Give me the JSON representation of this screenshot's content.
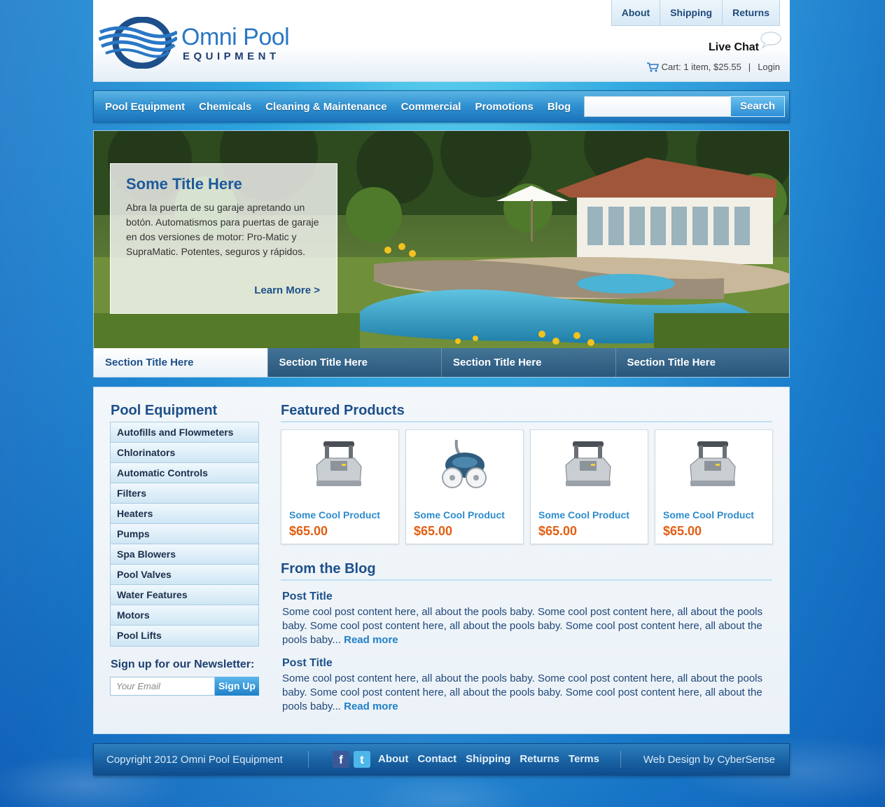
{
  "header": {
    "logo_line1": "Omni Pool",
    "logo_line2": "EQUIPMENT",
    "top_links": [
      "About",
      "Shipping",
      "Returns"
    ],
    "live_chat": "Live Chat",
    "cart": "Cart: 1 item, $25.55",
    "login": "Login"
  },
  "nav": {
    "items": [
      "Pool Equipment",
      "Chemicals",
      "Cleaning & Maintenance",
      "Commercial",
      "Promotions",
      "Blog"
    ],
    "search_value": "",
    "search_label": "Search"
  },
  "hero": {
    "title": "Some Title Here",
    "body": "Abra la puerta de su garaje apretando un botón. Automatismos para puertas de garaje en dos versiones de motor: Pro-Matic y SupraMatic. Potentes, seguros y rápidos.",
    "cta": "Learn More >",
    "tabs": [
      "Section Title Here",
      "Section Title Here",
      "Section Title Here",
      "Section Title Here"
    ]
  },
  "sidebar": {
    "title": "Pool Equipment",
    "items": [
      "Autofills and Flowmeters",
      "Chlorinators",
      "Automatic Controls",
      "Filters",
      "Heaters",
      "Pumps",
      "Spa Blowers",
      "Pool Valves",
      "Water Features",
      "Motors",
      "Pool Lifts"
    ],
    "newsletter_title": "Sign up for our Newsletter:",
    "email_placeholder": "Your Email",
    "signup_label": "Sign Up"
  },
  "featured": {
    "title": "Featured Products",
    "products": [
      {
        "name": "Some Cool Product",
        "price": "$65.00"
      },
      {
        "name": "Some Cool Product",
        "price": "$65.00"
      },
      {
        "name": "Some Cool Product",
        "price": "$65.00"
      },
      {
        "name": "Some Cool Product",
        "price": "$65.00"
      }
    ]
  },
  "blog": {
    "title": "From the Blog",
    "posts": [
      {
        "title": "Post Title",
        "body": "Some cool post content here, all about the pools baby. Some cool post content here, all about the pools baby. Some cool post content here, all about the pools baby. Some cool post content here, all about the pools baby... ",
        "more": "Read more"
      },
      {
        "title": "Post Title",
        "body": "Some cool post content here, all about the pools baby. Some cool post content here, all about the pools baby. Some cool post content here, all about the pools baby. Some cool post content here, all about the pools baby... ",
        "more": "Read more"
      }
    ]
  },
  "footer": {
    "copyright": "Copyright 2012 Omni Pool Equipment",
    "social_icons": [
      "facebook-icon",
      "twitter-icon"
    ],
    "links": [
      "About",
      "Contact",
      "Shipping",
      "Returns",
      "Terms"
    ],
    "credit": "Web Design by CyberSense"
  },
  "colors": {
    "brand_blue": "#2a77c6",
    "price_orange": "#e35e12",
    "nav_blue": "#2e8fd0"
  }
}
